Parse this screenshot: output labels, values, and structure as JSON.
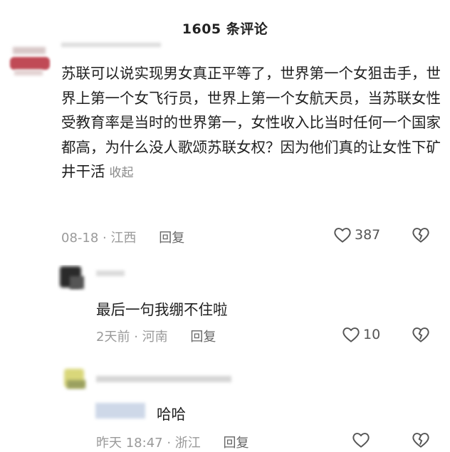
{
  "header": {
    "title": "1605 条评论"
  },
  "comments": [
    {
      "text": "苏联可以说实现男女真正平等了，世界第一个女狙击手，世界上第一个女飞行员，世界上第一个女航天员，当苏联女性受教育率是当时的世界第一，女性收入比当时任何一个国家都高，为什么没人歌颂苏联女权？因为他们真的让女性下矿井干活",
      "collapse_label": "收起",
      "time": "08-18",
      "location": "江西",
      "reply_label": "回复",
      "likes": "387"
    },
    {
      "text": "最后一句我绷不住啦",
      "time": "2天前",
      "location": "河南",
      "reply_label": "回复",
      "likes": "10"
    },
    {
      "text": "哈哈",
      "time": "昨天 18:47",
      "location": "浙江",
      "reply_label": "回复",
      "likes": ""
    }
  ],
  "colors": {
    "avatar1": "#c04a56",
    "avatar2": "#2a2a2a",
    "avatar3": "#d9d77a"
  }
}
